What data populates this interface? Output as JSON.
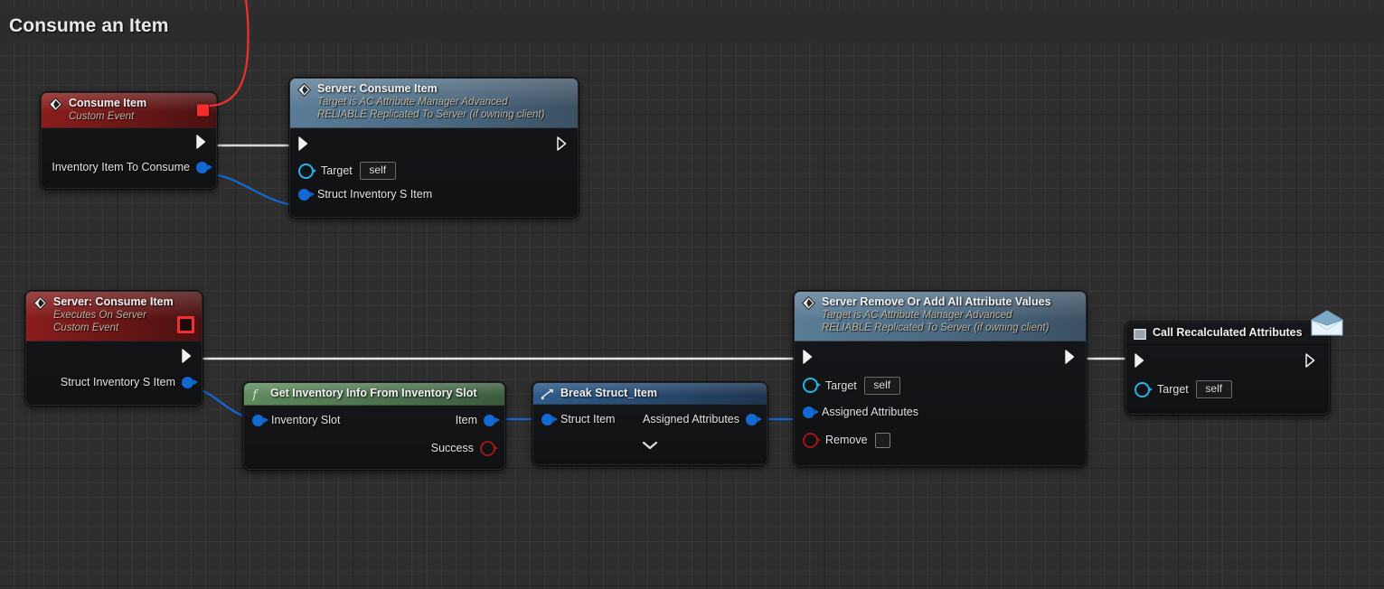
{
  "graph": {
    "title": "Consume an Item",
    "background_color": "#2e2e2e",
    "grid_minor_color": "#3a3a3a",
    "grid_major_color": "#1f1f1f"
  },
  "colors": {
    "exec_wire": "#ffffff",
    "object_wire": "#1269d3",
    "delegate_wire": "#ff2b2b",
    "event_header": "#7a1a1a",
    "function_header": "#4d6c84",
    "pure_function_header": "#4e7550",
    "struct_header": "#28496e",
    "self_pin": "#22b6e8",
    "bool_pin": "#a01616"
  },
  "nodes": [
    {
      "id": "consume-item-event",
      "title": "Consume Item",
      "subtitle": "Custom Event",
      "icon": "event-diamond-icon",
      "badge": "delegate-stop-badge",
      "kind": "event",
      "outputs_exec": [
        ""
      ],
      "outputs_data": [
        {
          "label": "Inventory Item To Consume",
          "pin": "object"
        }
      ]
    },
    {
      "id": "server-consume-item-call",
      "title": "Server: Consume Item",
      "subtitle_line1": "Target is AC Attribute Manager Advanced",
      "subtitle_line2": "RELIABLE Replicated To Server (if owning client)",
      "icon": "event-diamond-icon",
      "kind": "function-call",
      "inputs_data": [
        {
          "label": "Target",
          "pin": "self",
          "value": "self"
        },
        {
          "label": "Struct Inventory S Item",
          "pin": "object"
        }
      ]
    },
    {
      "id": "server-consume-item-event",
      "title": "Server: Consume Item",
      "subtitle_line1": "Executes On Server",
      "subtitle_line2": "Custom Event",
      "icon": "event-diamond-icon",
      "badge": "delegate-stop-badge-hollow",
      "kind": "event",
      "outputs_data": [
        {
          "label": "Struct Inventory S Item",
          "pin": "object"
        }
      ]
    },
    {
      "id": "get-inventory-info",
      "title": "Get Inventory Info From Inventory Slot",
      "icon": "function-fx-icon",
      "kind": "pure-function",
      "inputs_data": [
        {
          "label": "Inventory Slot",
          "pin": "object"
        }
      ],
      "outputs_data": [
        {
          "label": "Item",
          "pin": "object"
        },
        {
          "label": "Success",
          "pin": "bool"
        }
      ]
    },
    {
      "id": "break-struct-item",
      "title": "Break Struct_Item",
      "icon": "break-struct-icon",
      "kind": "struct",
      "inputs_data": [
        {
          "label": "Struct Item",
          "pin": "object"
        }
      ],
      "outputs_data": [
        {
          "label": "Assigned Attributes",
          "pin": "object"
        }
      ],
      "expander": "chevron-down-icon"
    },
    {
      "id": "server-remove-or-add",
      "title": "Server Remove Or Add All Attribute Values",
      "subtitle_line1": "Target is AC Attribute Manager Advanced",
      "subtitle_line2": "RELIABLE Replicated To Server (if owning client)",
      "icon": "event-diamond-icon",
      "kind": "function-call",
      "inputs_data": [
        {
          "label": "Target",
          "pin": "self",
          "value": "self"
        },
        {
          "label": "Assigned Attributes",
          "pin": "object"
        },
        {
          "label": "Remove",
          "pin": "bool",
          "value": ""
        }
      ]
    },
    {
      "id": "call-recalculated-attributes",
      "title": "Call Recalculated Attributes",
      "icon": "dispatcher-square-icon",
      "badge_icon": "envelope-icon",
      "kind": "dispatcher",
      "inputs_data": [
        {
          "label": "Target",
          "pin": "self",
          "value": "self"
        }
      ]
    }
  ]
}
